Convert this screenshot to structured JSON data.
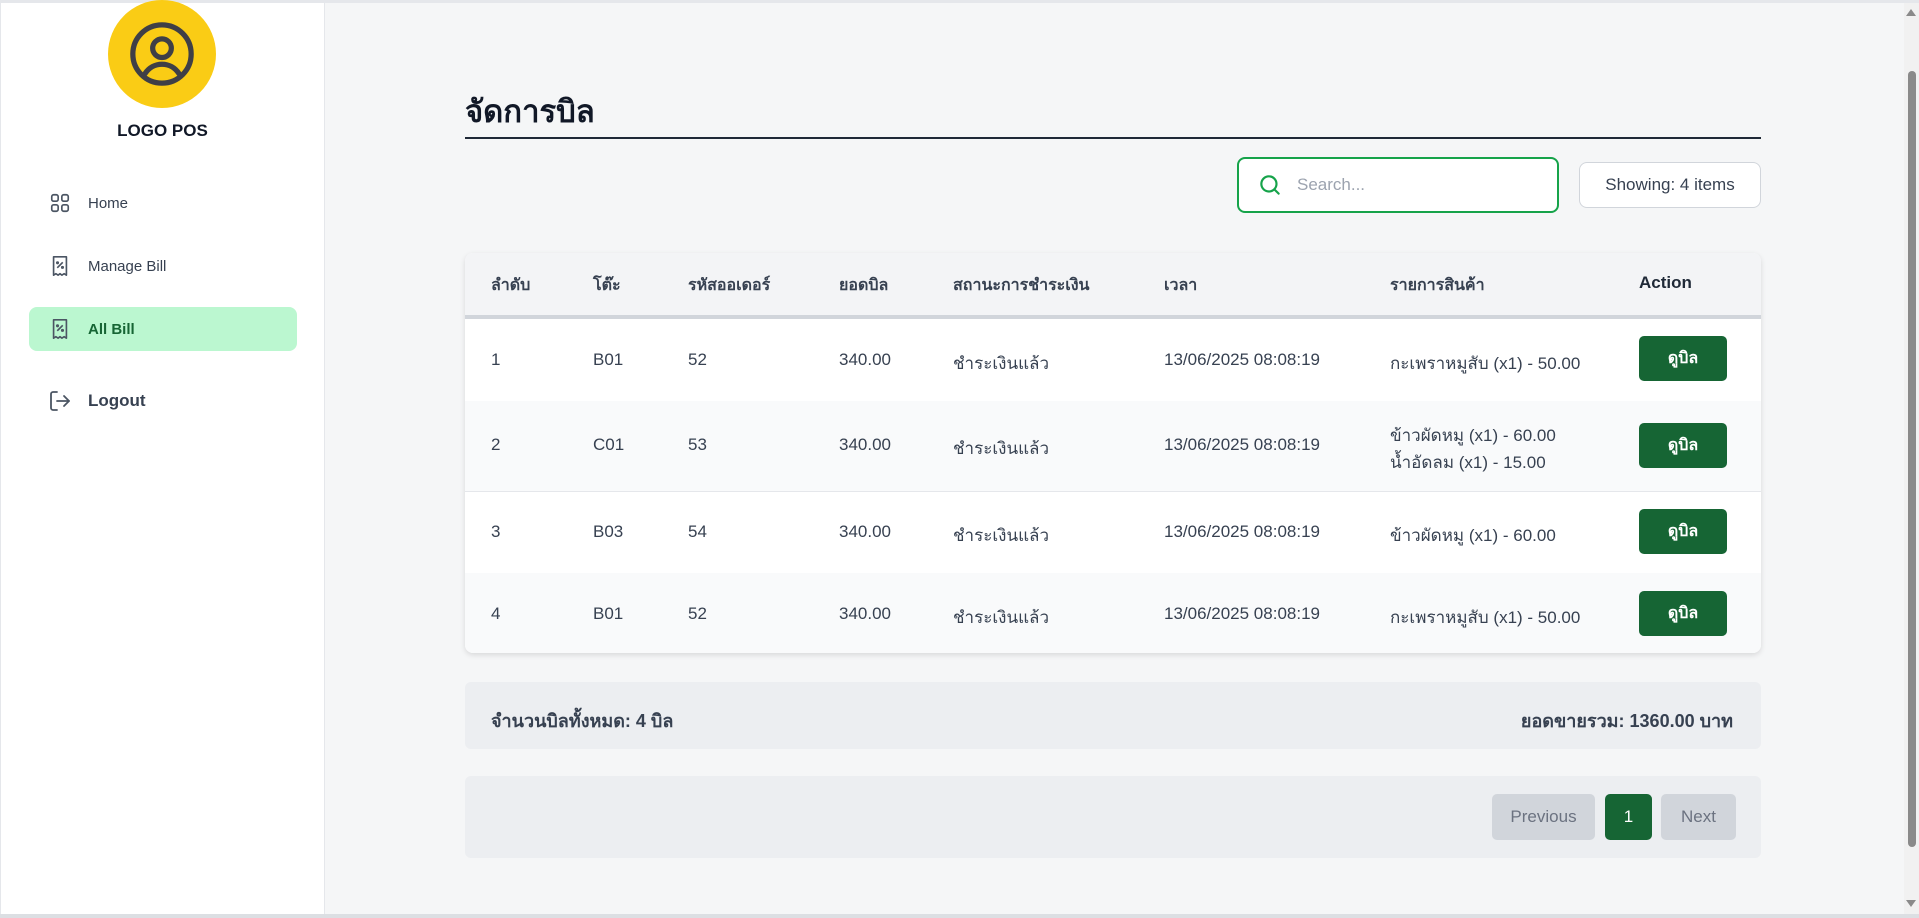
{
  "sidebar": {
    "logo_text": "LOGO POS",
    "items": [
      {
        "label": "Home",
        "icon": "grid-icon"
      },
      {
        "label": "Manage Bill",
        "icon": "receipt-icon"
      },
      {
        "label": "All Bill",
        "icon": "receipt-icon",
        "active": true
      },
      {
        "label": "Logout",
        "icon": "logout-icon"
      }
    ]
  },
  "page": {
    "title": "จัดการบิล"
  },
  "search": {
    "placeholder": "Search...",
    "value": ""
  },
  "showing": "Showing: 4 items",
  "table": {
    "headers": [
      "ลำดับ",
      "โต๊ะ",
      "รหัสออเดอร์",
      "ยอดบิล",
      "สถานะการชำระเงิน",
      "เวลา",
      "รายการสินค้า",
      "Action"
    ],
    "rows": [
      {
        "no": "1",
        "table": "B01",
        "order": "52",
        "amount": "340.00",
        "status": "ชำระเงินแล้ว",
        "time": "13/06/2025 08:08:19",
        "items": [
          "กะเพราหมูสับ (x1) - 50.00"
        ],
        "action": "ดูบิล"
      },
      {
        "no": "2",
        "table": "C01",
        "order": "53",
        "amount": "340.00",
        "status": "ชำระเงินแล้ว",
        "time": "13/06/2025 08:08:19",
        "items": [
          "ข้าวผัดหมู (x1) - 60.00",
          "น้ำอัดลม (x1) - 15.00"
        ],
        "action": "ดูบิล"
      },
      {
        "no": "3",
        "table": "B03",
        "order": "54",
        "amount": "340.00",
        "status": "ชำระเงินแล้ว",
        "time": "13/06/2025 08:08:19",
        "items": [
          "ข้าวผัดหมู (x1) - 60.00"
        ],
        "action": "ดูบิล"
      },
      {
        "no": "4",
        "table": "B01",
        "order": "52",
        "amount": "340.00",
        "status": "ชำระเงินแล้ว",
        "time": "13/06/2025 08:08:19",
        "items": [
          "กะเพราหมูสับ (x1) - 50.00"
        ],
        "action": "ดูบิล"
      }
    ]
  },
  "summary": {
    "total_bills": "จำนวนบิลทั้งหมด: 4 บิล",
    "total_sales": "ยอดขายรวม: 1360.00 บาท"
  },
  "pagination": {
    "previous": "Previous",
    "current": "1",
    "next": "Next"
  },
  "colors": {
    "accent": "#166534",
    "active_nav_bg": "#bbf7d0",
    "logo_bg": "#facc15",
    "search_border": "#16a34a"
  }
}
